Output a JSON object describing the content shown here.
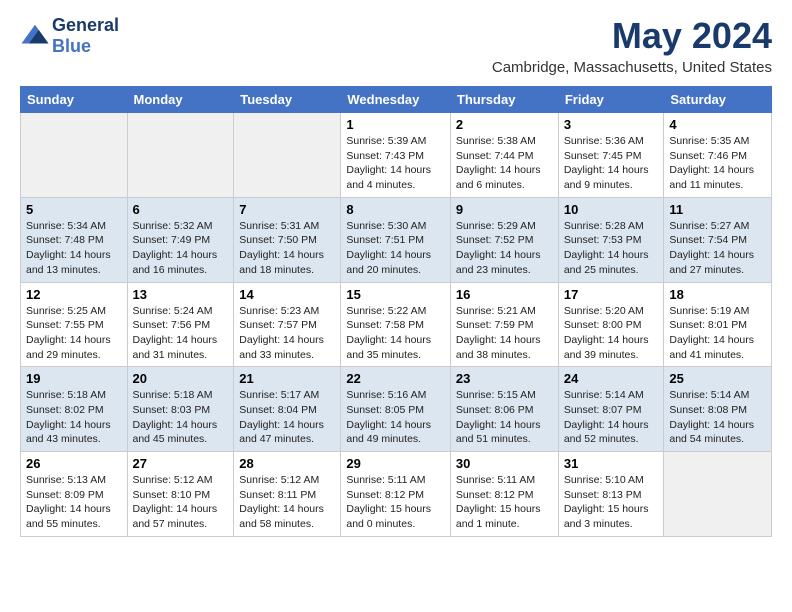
{
  "logo": {
    "line1": "General",
    "line2": "Blue"
  },
  "title": "May 2024",
  "location": "Cambridge, Massachusetts, United States",
  "weekdays": [
    "Sunday",
    "Monday",
    "Tuesday",
    "Wednesday",
    "Thursday",
    "Friday",
    "Saturday"
  ],
  "weeks": [
    [
      {
        "num": "",
        "info": ""
      },
      {
        "num": "",
        "info": ""
      },
      {
        "num": "",
        "info": ""
      },
      {
        "num": "1",
        "info": "Sunrise: 5:39 AM\nSunset: 7:43 PM\nDaylight: 14 hours\nand 4 minutes."
      },
      {
        "num": "2",
        "info": "Sunrise: 5:38 AM\nSunset: 7:44 PM\nDaylight: 14 hours\nand 6 minutes."
      },
      {
        "num": "3",
        "info": "Sunrise: 5:36 AM\nSunset: 7:45 PM\nDaylight: 14 hours\nand 9 minutes."
      },
      {
        "num": "4",
        "info": "Sunrise: 5:35 AM\nSunset: 7:46 PM\nDaylight: 14 hours\nand 11 minutes."
      }
    ],
    [
      {
        "num": "5",
        "info": "Sunrise: 5:34 AM\nSunset: 7:48 PM\nDaylight: 14 hours\nand 13 minutes."
      },
      {
        "num": "6",
        "info": "Sunrise: 5:32 AM\nSunset: 7:49 PM\nDaylight: 14 hours\nand 16 minutes."
      },
      {
        "num": "7",
        "info": "Sunrise: 5:31 AM\nSunset: 7:50 PM\nDaylight: 14 hours\nand 18 minutes."
      },
      {
        "num": "8",
        "info": "Sunrise: 5:30 AM\nSunset: 7:51 PM\nDaylight: 14 hours\nand 20 minutes."
      },
      {
        "num": "9",
        "info": "Sunrise: 5:29 AM\nSunset: 7:52 PM\nDaylight: 14 hours\nand 23 minutes."
      },
      {
        "num": "10",
        "info": "Sunrise: 5:28 AM\nSunset: 7:53 PM\nDaylight: 14 hours\nand 25 minutes."
      },
      {
        "num": "11",
        "info": "Sunrise: 5:27 AM\nSunset: 7:54 PM\nDaylight: 14 hours\nand 27 minutes."
      }
    ],
    [
      {
        "num": "12",
        "info": "Sunrise: 5:25 AM\nSunset: 7:55 PM\nDaylight: 14 hours\nand 29 minutes."
      },
      {
        "num": "13",
        "info": "Sunrise: 5:24 AM\nSunset: 7:56 PM\nDaylight: 14 hours\nand 31 minutes."
      },
      {
        "num": "14",
        "info": "Sunrise: 5:23 AM\nSunset: 7:57 PM\nDaylight: 14 hours\nand 33 minutes."
      },
      {
        "num": "15",
        "info": "Sunrise: 5:22 AM\nSunset: 7:58 PM\nDaylight: 14 hours\nand 35 minutes."
      },
      {
        "num": "16",
        "info": "Sunrise: 5:21 AM\nSunset: 7:59 PM\nDaylight: 14 hours\nand 38 minutes."
      },
      {
        "num": "17",
        "info": "Sunrise: 5:20 AM\nSunset: 8:00 PM\nDaylight: 14 hours\nand 39 minutes."
      },
      {
        "num": "18",
        "info": "Sunrise: 5:19 AM\nSunset: 8:01 PM\nDaylight: 14 hours\nand 41 minutes."
      }
    ],
    [
      {
        "num": "19",
        "info": "Sunrise: 5:18 AM\nSunset: 8:02 PM\nDaylight: 14 hours\nand 43 minutes."
      },
      {
        "num": "20",
        "info": "Sunrise: 5:18 AM\nSunset: 8:03 PM\nDaylight: 14 hours\nand 45 minutes."
      },
      {
        "num": "21",
        "info": "Sunrise: 5:17 AM\nSunset: 8:04 PM\nDaylight: 14 hours\nand 47 minutes."
      },
      {
        "num": "22",
        "info": "Sunrise: 5:16 AM\nSunset: 8:05 PM\nDaylight: 14 hours\nand 49 minutes."
      },
      {
        "num": "23",
        "info": "Sunrise: 5:15 AM\nSunset: 8:06 PM\nDaylight: 14 hours\nand 51 minutes."
      },
      {
        "num": "24",
        "info": "Sunrise: 5:14 AM\nSunset: 8:07 PM\nDaylight: 14 hours\nand 52 minutes."
      },
      {
        "num": "25",
        "info": "Sunrise: 5:14 AM\nSunset: 8:08 PM\nDaylight: 14 hours\nand 54 minutes."
      }
    ],
    [
      {
        "num": "26",
        "info": "Sunrise: 5:13 AM\nSunset: 8:09 PM\nDaylight: 14 hours\nand 55 minutes."
      },
      {
        "num": "27",
        "info": "Sunrise: 5:12 AM\nSunset: 8:10 PM\nDaylight: 14 hours\nand 57 minutes."
      },
      {
        "num": "28",
        "info": "Sunrise: 5:12 AM\nSunset: 8:11 PM\nDaylight: 14 hours\nand 58 minutes."
      },
      {
        "num": "29",
        "info": "Sunrise: 5:11 AM\nSunset: 8:12 PM\nDaylight: 15 hours\nand 0 minutes."
      },
      {
        "num": "30",
        "info": "Sunrise: 5:11 AM\nSunset: 8:12 PM\nDaylight: 15 hours\nand 1 minute."
      },
      {
        "num": "31",
        "info": "Sunrise: 5:10 AM\nSunset: 8:13 PM\nDaylight: 15 hours\nand 3 minutes."
      },
      {
        "num": "",
        "info": ""
      }
    ]
  ]
}
